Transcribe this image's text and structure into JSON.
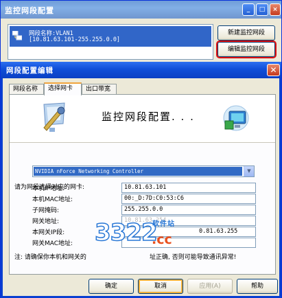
{
  "main_window": {
    "title": "监控网段配置",
    "segment_list": {
      "selected_item": {
        "name_line": "网段名称:VLAN1",
        "range_line": "[10.81.63.101-255.255.0.0]"
      }
    },
    "buttons": {
      "new_segment": "新建监控网段",
      "edit_segment": "编辑监控网段"
    }
  },
  "dialog": {
    "title": "网段配置编辑",
    "close_glyph": "✕",
    "tabs": [
      "网段名称",
      "选择网卡",
      "出口带宽"
    ],
    "active_tab_index": 1,
    "banner_title": "监控网段配置. . .",
    "nic_prompt": "请为网段选择对应的网卡:",
    "nic_select": {
      "value": "NVIDIA nForce Networking Controller"
    },
    "fields": [
      {
        "label": "本机IP地址:",
        "value": "10.81.63.101"
      },
      {
        "label": "本机MAC地址:",
        "value": "00:_D:7D:C0:53:C6"
      },
      {
        "label": "子网掩码:",
        "value": "255.255.0.0"
      },
      {
        "label": "网关地址:",
        "value": "10.81.63.254"
      },
      {
        "label": "本网关IP段:",
        "value": "0.81.63.255"
      },
      {
        "label": "网关MAC地址:",
        "value": ""
      }
    ],
    "note_prefix": "注: 请确保你本机和网关的",
    "note_suffix": "址正确, 否则可能导致通讯异常!",
    "buttons": {
      "ok": "确定",
      "cancel": "取消",
      "apply": "应用(A)",
      "help": "帮助"
    }
  },
  "watermark": {
    "number": "3322",
    "domain": ".cc",
    "tagline": "软件站"
  },
  "icons": {
    "minimize": "minimize-icon",
    "maximize": "maximize-icon",
    "close": "close-icon",
    "network": "network-icon",
    "monitor": "monitor-config-icon"
  },
  "colors": {
    "title_blue": "#0a3fc4",
    "selection_blue": "#3166c8",
    "highlight_red": "#e01010"
  }
}
